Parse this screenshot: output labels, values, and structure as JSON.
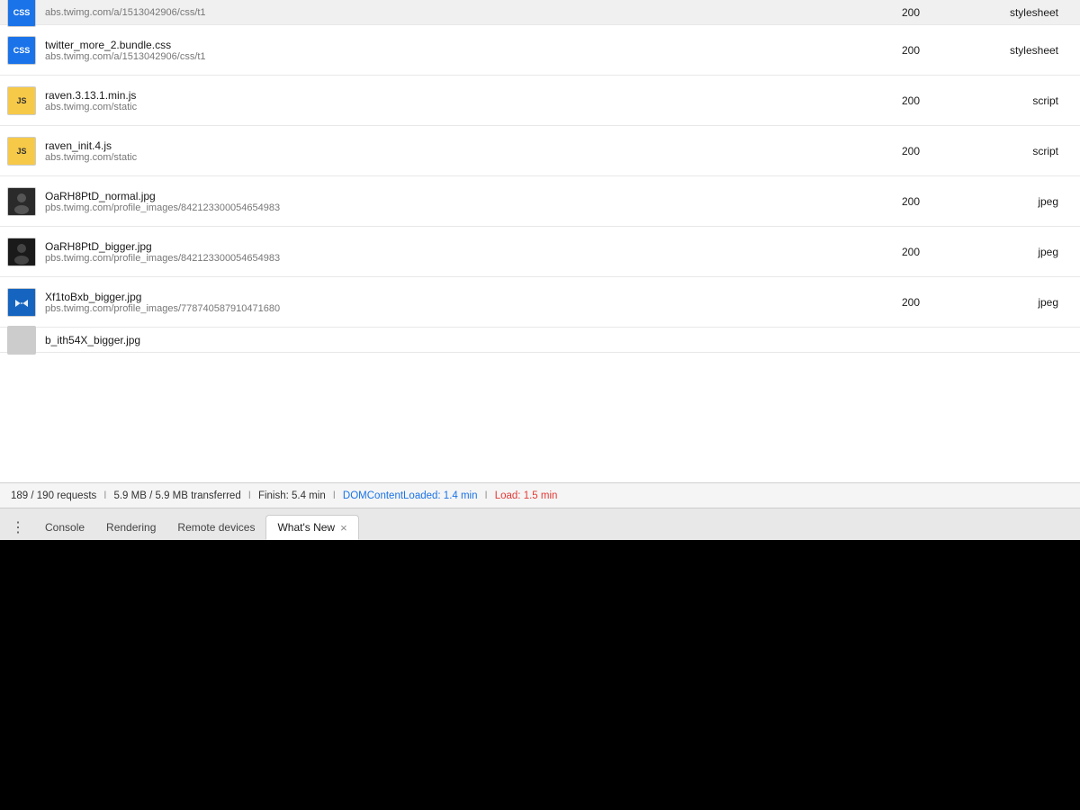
{
  "devtools": {
    "rows": [
      {
        "id": "row-css1",
        "icon_type": "css",
        "name": "",
        "url": "abs.twimg.com/a/1513042906/css/t1",
        "status": "200",
        "type": "stylesheet",
        "partial": true
      },
      {
        "id": "row-css2",
        "icon_type": "css",
        "name": "twitter_more_2.bundle.css",
        "url": "abs.twimg.com/a/1513042906/css/t1",
        "status": "200",
        "type": "stylesheet",
        "partial": false
      },
      {
        "id": "row-js1",
        "icon_type": "js",
        "name": "raven.3.13.1.min.js",
        "url": "abs.twimg.com/static",
        "status": "200",
        "type": "script",
        "partial": false
      },
      {
        "id": "row-js2",
        "icon_type": "js",
        "name": "raven_init.4.js",
        "url": "abs.twimg.com/static",
        "status": "200",
        "type": "script",
        "partial": false
      },
      {
        "id": "row-img1",
        "icon_type": "img_face1",
        "name": "OaRH8PtD_normal.jpg",
        "url": "pbs.twimg.com/profile_images/842123300054654983",
        "status": "200",
        "type": "jpeg",
        "partial": false
      },
      {
        "id": "row-img2",
        "icon_type": "img_face2",
        "name": "OaRH8PtD_bigger.jpg",
        "url": "pbs.twimg.com/profile_images/842123300054654983",
        "status": "200",
        "type": "jpeg",
        "partial": false
      },
      {
        "id": "row-img3",
        "icon_type": "img_bowtie",
        "name": "Xf1toBxb_bigger.jpg",
        "url": "pbs.twimg.com/profile_images/778740587910471680",
        "status": "200",
        "type": "jpeg",
        "partial": false
      },
      {
        "id": "row-img4-partial",
        "icon_type": "img_partial",
        "name": "b_ith54X_bigger.jpg",
        "url": "",
        "status": "",
        "type": "",
        "partial": true
      }
    ],
    "status_bar": {
      "requests": "189 / 190 requests",
      "sep1": "I",
      "transferred": "5.9 MB / 5.9 MB transferred",
      "sep2": "I",
      "finish": "Finish: 5.4 min",
      "sep3": "I",
      "domcontent_label": "DOMContentLoaded: 1.4 min",
      "sep4": "I",
      "load_label": "Load: 1.5 min"
    },
    "tabs_bar": {
      "more_icon": "⋮",
      "tabs": [
        {
          "id": "tab-console",
          "label": "Console",
          "active": false,
          "closeable": false
        },
        {
          "id": "tab-rendering",
          "label": "Rendering",
          "active": false,
          "closeable": false
        },
        {
          "id": "tab-remote-devices",
          "label": "Remote devices",
          "active": false,
          "closeable": false
        },
        {
          "id": "tab-whats-new",
          "label": "What's New",
          "active": true,
          "closeable": true
        }
      ],
      "close_icon": "×"
    }
  }
}
